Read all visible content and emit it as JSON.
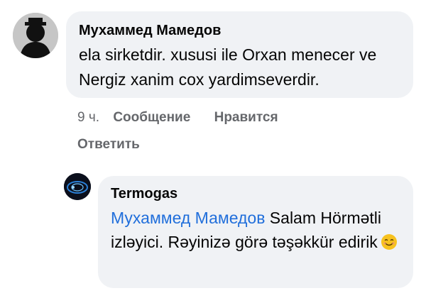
{
  "comment": {
    "author": "Мухаммед Мамедов",
    "text": "ela sirketdir. xususi ile Orxan menecer ve Nergiz xanim cox yardimseverdir.",
    "time": "9 ч.",
    "actions": {
      "message": "Сообщение",
      "like": "Нравится",
      "reply": "Ответить"
    }
  },
  "reply": {
    "author": "Termogas",
    "mention": "Мухаммед Мамедов",
    "text": " Salam Hörmətli izləyici. Rəyinizə görə təşəkkür edirik",
    "emoji": "smiling-face-emoji"
  },
  "colors": {
    "bubble": "#f0f2f5",
    "secondary_text": "#65676b",
    "mention": "#216fdb",
    "emoji": "#f7c21f"
  }
}
